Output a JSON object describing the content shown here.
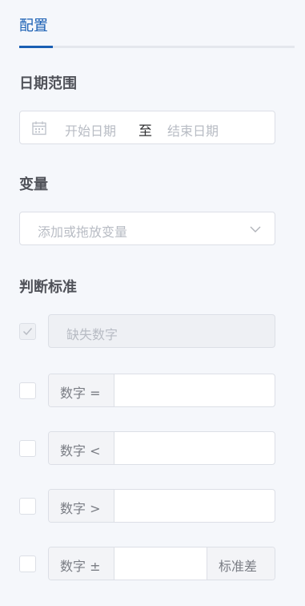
{
  "tabs": {
    "active": "配置"
  },
  "date_range": {
    "title": "日期范围",
    "start_placeholder": "开始日期",
    "separator": "至",
    "end_placeholder": "结束日期"
  },
  "variable": {
    "title": "变量",
    "placeholder": "添加或拖放变量"
  },
  "criteria": {
    "title": "判断标准",
    "missing": {
      "label": "缺失数字",
      "checked": true,
      "disabled": true
    },
    "rules": [
      {
        "prefix": "数字 =",
        "value": "",
        "checked": false
      },
      {
        "prefix": "数字 <",
        "value": "",
        "checked": false
      },
      {
        "prefix": "数字 >",
        "value": "",
        "checked": false
      },
      {
        "prefix": "数字 ±",
        "value": "",
        "suffix": "标准差",
        "checked": false
      }
    ]
  },
  "colors": {
    "accent": "#1a5fb4",
    "background": "#f5f7fb",
    "border": "#dcdfe6",
    "placeholder": "#b8bcc4"
  },
  "icons": [
    "calendar-icon",
    "chevron-down-icon",
    "check-icon"
  ]
}
